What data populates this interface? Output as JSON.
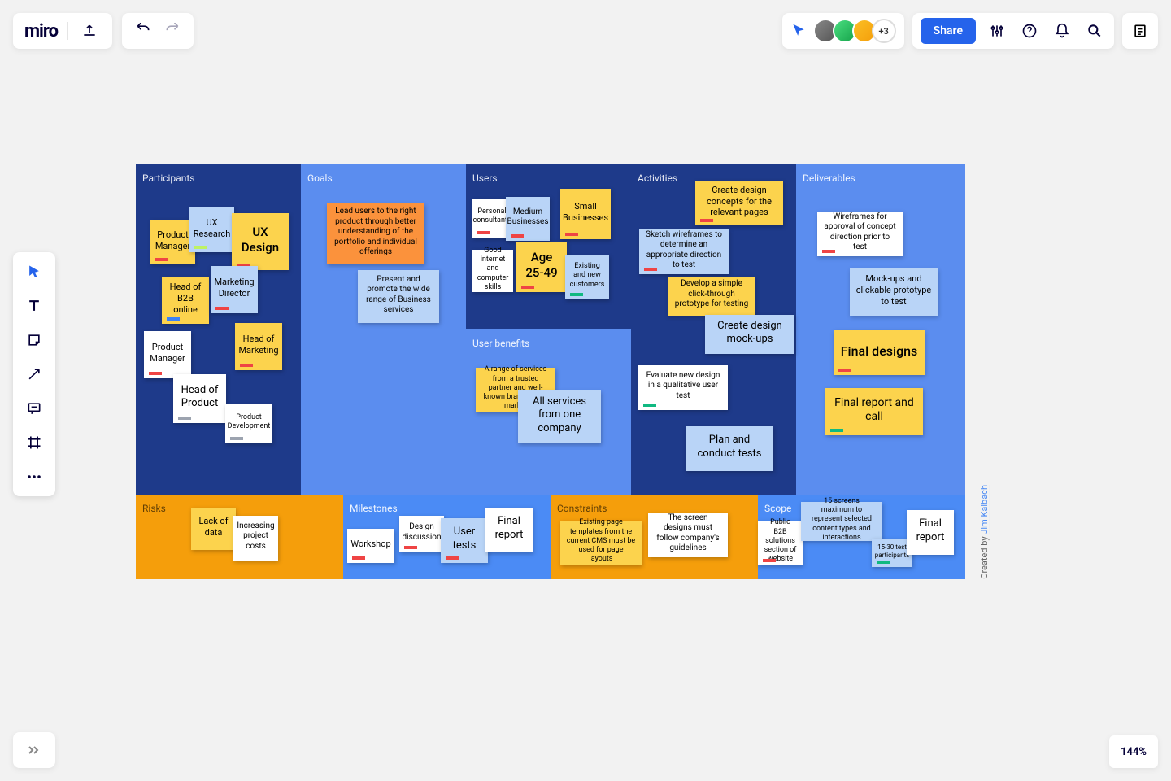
{
  "logo": "miro",
  "header": {
    "share_label": "Share",
    "extra_users": "+3"
  },
  "zoom": "144%",
  "credit_prefix": "Created by ",
  "credit_name": "Jim Kalbach",
  "regions": {
    "participants": "Participants",
    "goals": "Goals",
    "users": "Users",
    "user_benefits": "User benefits",
    "activities": "Activities",
    "deliverables": "Deliverables",
    "risks": "Risks",
    "milestones": "Milestones",
    "constraints": "Constraints",
    "scope": "Scope"
  },
  "notes": {
    "p1": "Product Manager",
    "p2": "UX Research",
    "p3": "UX Design",
    "p4": "Head of B2B online",
    "p5": "Marketing Director",
    "p6": "Product Manager",
    "p7": "Head of Marketing",
    "p8": "Head of Product",
    "p9": "Product Development",
    "g1": "Lead users to the right product through better understanding of the portfolio and individual offerings",
    "g2": "Present and promote the wide range of Business services",
    "u1": "Personal consultants",
    "u2": "Medium Businesses",
    "u3": "Small Businesses",
    "u4": "Good internet and computer skills",
    "u5": "Age 25-49",
    "u6": "Existing and new customers",
    "ub1": "A range of services from a trusted partner and well-known brand on the market",
    "ub2": "All services from one company",
    "a1": "Create design concepts for the relevant pages",
    "a2": "Sketch wireframes to determine an appropriate direction to test",
    "a3": "Develop a simple click-through prototype for testing",
    "a4": "Create design mock-ups",
    "a5": "Evaluate new design in a qualitative user test",
    "a6": "Plan and conduct tests",
    "d1": "Wireframes for approval of concept direction prior to test",
    "d2": "Mock-ups and clickable prototype to test",
    "d3": "Final designs",
    "d4": "Final report and call",
    "r1": "Lack of data",
    "r2": "Increasing project costs",
    "m1": "Workshop",
    "m2": "Design discussion",
    "m3": "User tests",
    "m4": "Final report",
    "c1": "Existing page templates from the current CMS must be used for page layouts",
    "c2": "The screen designs must follow company's guidelines",
    "s1": "Public B2B solutions section of website",
    "s2": "15 screens maximum to represent selected content types and interactions",
    "s3": "15-30 test participants",
    "s4": "Final report"
  }
}
